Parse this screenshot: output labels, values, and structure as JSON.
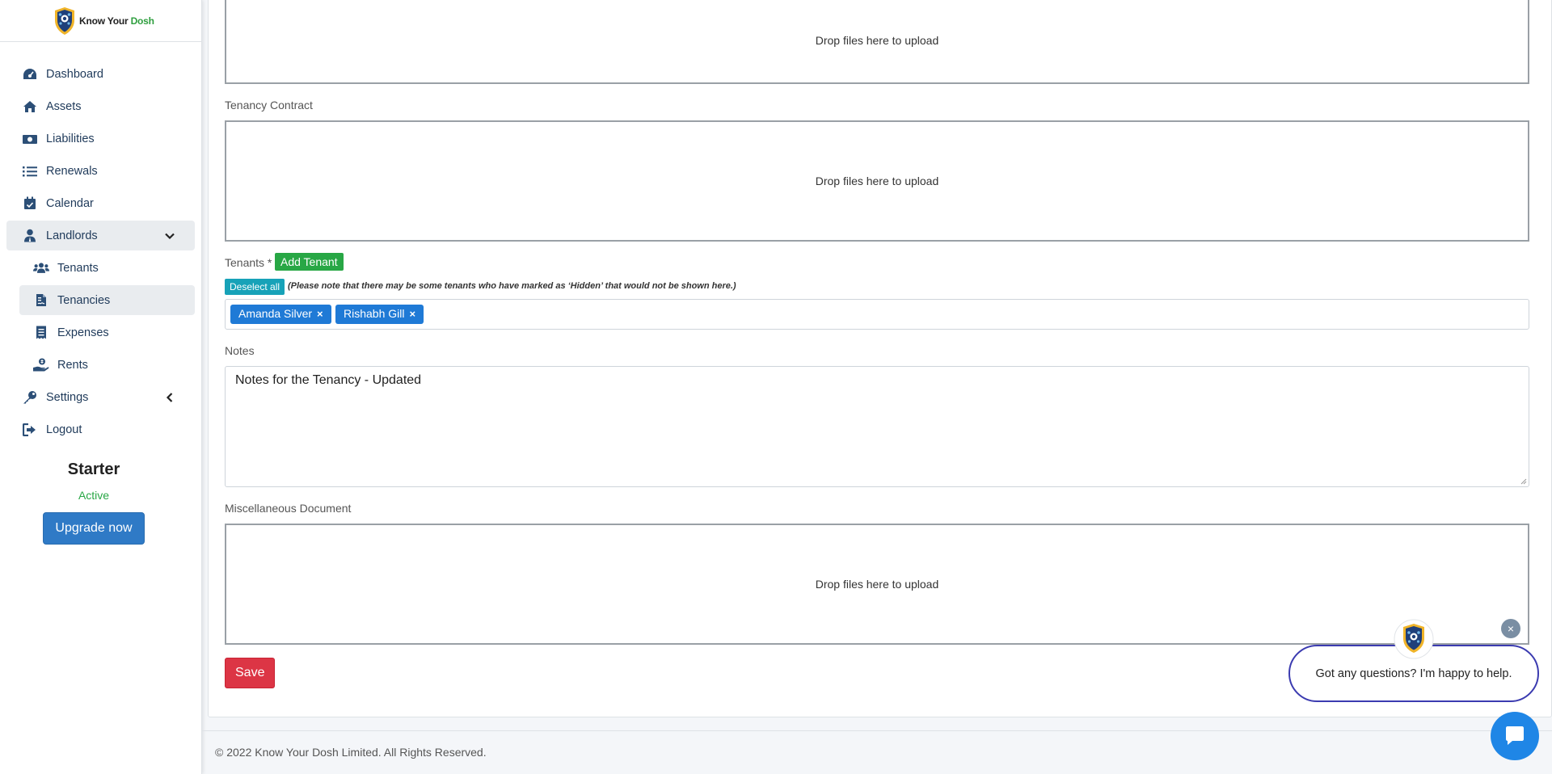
{
  "brand": {
    "part1": "Know Your ",
    "part2": "Dosh"
  },
  "sidebar": {
    "items": [
      {
        "label": "Dashboard",
        "icon": "tachometer-icon"
      },
      {
        "label": "Assets",
        "icon": "home-icon"
      },
      {
        "label": "Liabilities",
        "icon": "money-bill-icon"
      },
      {
        "label": "Renewals",
        "icon": "list-icon"
      },
      {
        "label": "Calendar",
        "icon": "calendar-check-icon"
      },
      {
        "label": "Landlords",
        "icon": "user-tie-icon",
        "expanded": true
      },
      {
        "label": "Tenants",
        "icon": "users-icon"
      },
      {
        "label": "Tenancies",
        "icon": "file-contract-icon",
        "active": true
      },
      {
        "label": "Expenses",
        "icon": "receipt-icon"
      },
      {
        "label": "Rents",
        "icon": "hand-holding-usd-icon"
      },
      {
        "label": "Settings",
        "icon": "key-icon"
      },
      {
        "label": "Logout",
        "icon": "sign-out-icon"
      }
    ]
  },
  "plan": {
    "name": "Starter",
    "status": "Active",
    "upgrade_label": "Upgrade now"
  },
  "form": {
    "dropzone_text": "Drop files here to upload",
    "tenancy_contract_label": "Tenancy Contract",
    "tenants_label": "Tenants *",
    "add_tenant_label": "Add Tenant",
    "deselect_label": "Deselect all",
    "tenants_note": "(Please note that there may be some tenants who have marked as ‘Hidden’ that would not be shown here.)",
    "tenants": [
      {
        "name": "Amanda Silver",
        "remove": "×"
      },
      {
        "name": "Rishabh Gill",
        "remove": "×"
      }
    ],
    "notes_label": "Notes",
    "notes_value": "Notes for the Tenancy - Updated",
    "misc_label": "Miscellaneous Document",
    "save_label": "Save"
  },
  "footer": {
    "text": "© 2022 Know Your Dosh Limited. All Rights Reserved."
  },
  "chat": {
    "message": "Got any questions? I'm happy to help.",
    "close": "×"
  },
  "colors": {
    "primary": "#2f7ac6",
    "success": "#28a745",
    "danger": "#dc3545",
    "info": "#17a2b8",
    "tag": "#1f7ad6",
    "chat_border": "#3b3bb0",
    "chat_launcher": "#1f86e6"
  }
}
